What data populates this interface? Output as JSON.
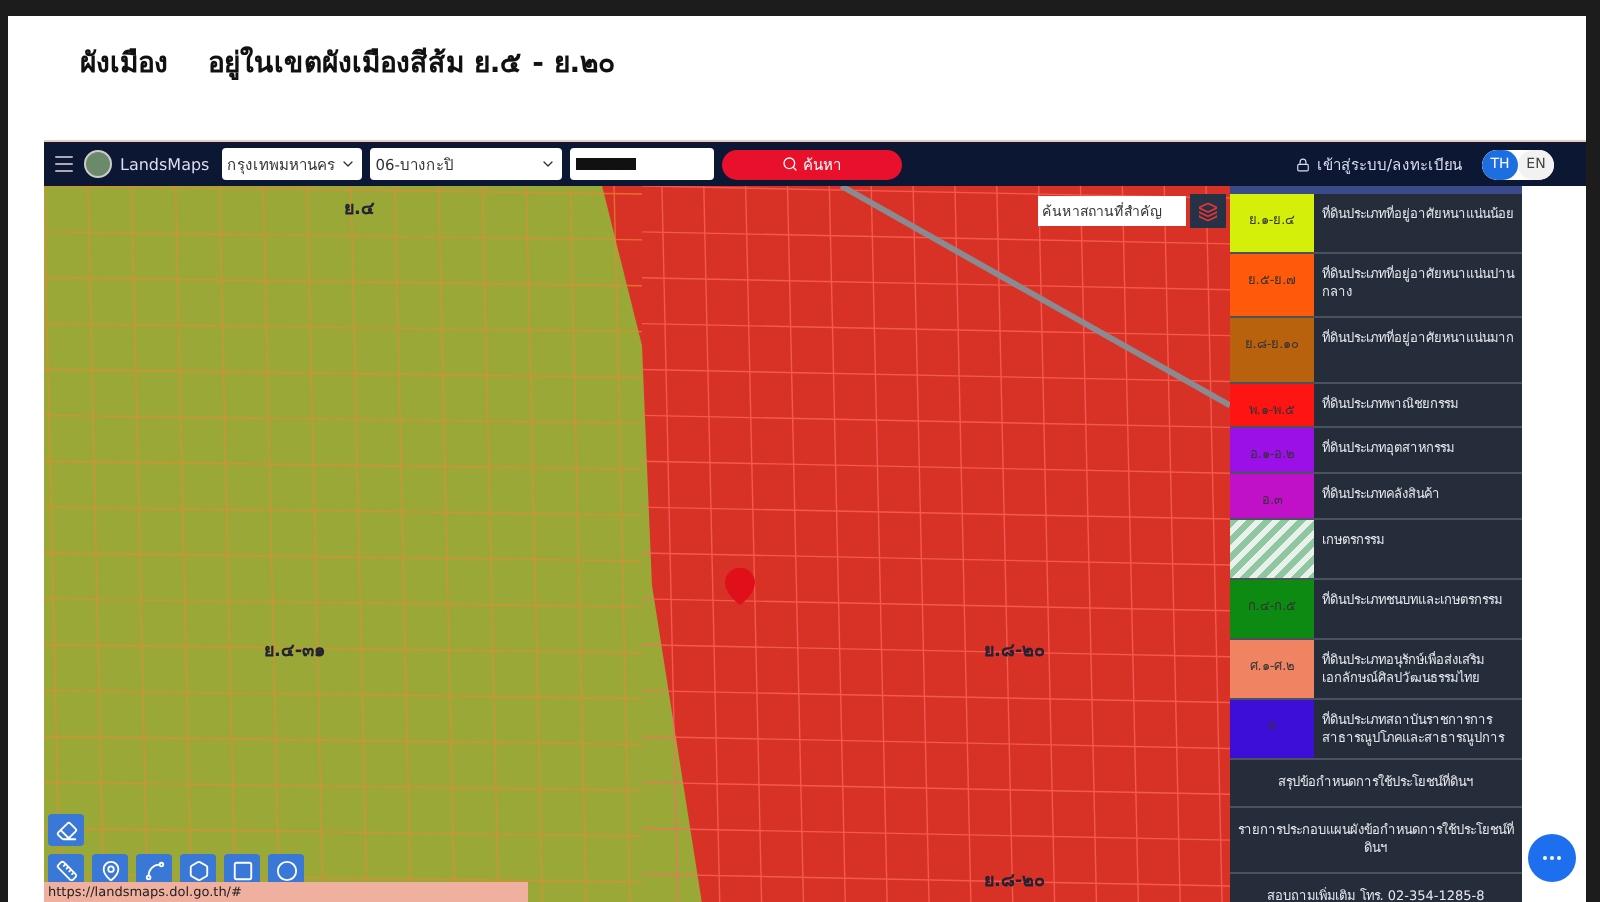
{
  "slide_title": {
    "heading": "ผังเมือง",
    "subtitle": "อยู่ในเขตผังเมืองสีส้ม ย.๕ - ย.๒๐"
  },
  "navbar": {
    "brand": "LandsMaps",
    "province": "กรุงเทพมหานคร",
    "district": "06-บางกะปิ",
    "parcel_redacted": true,
    "search_button": "ค้นหา",
    "login": "เข้าสู่ระบบ/ลงทะเบียน",
    "languages": [
      {
        "label": "TH",
        "selected": true
      },
      {
        "label": "EN",
        "selected": false
      }
    ]
  },
  "map": {
    "place_search": {
      "placeholder": "ค้นหาสถานที่สำคัญ"
    },
    "zone_labels": [
      "ย.๔",
      "ย.๔-๓๑",
      "ย.๘-๒๐",
      "ย.๘-๒๐"
    ],
    "status_url": "https://landsmaps.dol.go.th/#"
  },
  "legend": {
    "items": [
      {
        "kind": "solid",
        "code": "ย.๑-ย.๔",
        "color": "#d4ef0a",
        "description": "ที่ดินประเภทที่อยู่อาศัยหนาแน่นน้อย"
      },
      {
        "kind": "solid",
        "code": "ย.๕-ย.๗",
        "color": "#ff5a0a",
        "description": "ที่ดินประเภทที่อยู่อาศัยหนาแน่นปานกลาง"
      },
      {
        "kind": "solid",
        "code": "ย.๘-ย.๑๐",
        "color": "#b8620e",
        "description": "ที่ดินประเภทที่อยู่อาศัยหนาแน่นมาก"
      },
      {
        "kind": "solid",
        "code": "พ.๑-พ.๕",
        "color": "#ff1414",
        "description": "ที่ดินประเภทพาณิชยกรรม"
      },
      {
        "kind": "solid",
        "code": "อ.๑-อ.๒",
        "color": "#9a10e6",
        "description": "ที่ดินประเภทอุตสาหกรรม"
      },
      {
        "kind": "solid",
        "code": "อ.๓",
        "color": "#c010c8",
        "description": "ที่ดินประเภทคลังสินค้า"
      },
      {
        "kind": "hatched",
        "color": "#8fc8a0",
        "description": "เกษตรกรรม"
      },
      {
        "kind": "solid",
        "code": "ก.๔-ก.๕",
        "color": "#0c8a12",
        "description": "ที่ดินประเภทชนบทและเกษตรกรรม"
      },
      {
        "kind": "solid",
        "code": "ศ.๑-ศ.๒",
        "color": "#f08462",
        "description": "ที่ดินประเภทอนุรักษ์เพื่อส่งเสริมเอกลักษณ์ศิลปวัฒนธรรมไทย"
      },
      {
        "kind": "solid",
        "code": "ส",
        "color": "#3c0ed8",
        "description": "ที่ดินประเภทสถาบันราชการการสาธารณูปโภคและสาธารณูปการ"
      }
    ],
    "links": [
      "สรุปข้อกำหนดการใช้ประโยชน์ที่ดินฯ",
      "รายการประกอบแผนผังข้อกำหนดการใช้ประโยชน์ที่ดินฯ",
      "สอบถามเพิ่มเติม โทร. 02-354-1285-8"
    ]
  }
}
